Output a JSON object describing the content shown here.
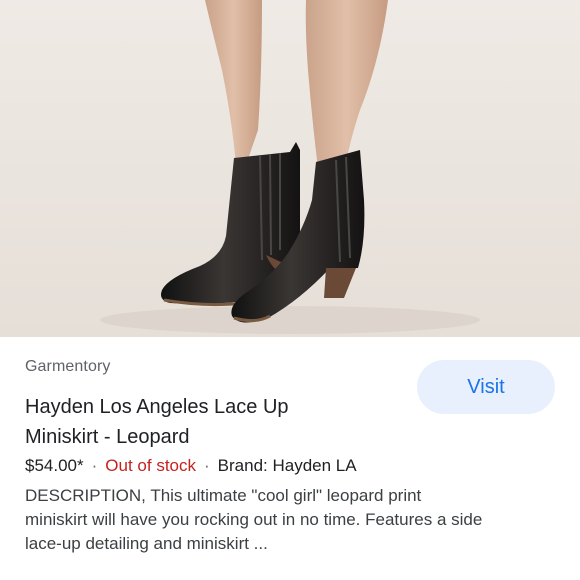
{
  "listing": {
    "image_alt": "Black leather ankle boots",
    "source": "Garmentory",
    "visit_label": "Visit",
    "title_lines": [
      "Hayden Los Angeles Lace Up",
      "Miniskirt - Leopard"
    ],
    "price": "$54.00*",
    "separator": "·",
    "stock_status": "Out of stock",
    "brand": "Brand: Hayden LA",
    "description_lines": [
      "DESCRIPTION, This ultimate \"cool girl\" leopard print",
      "miniskirt will have you rocking out in no time. Features a side",
      "lace-up detailing and miniskirt ..."
    ]
  },
  "colors": {
    "accent": "#1a73e8",
    "visit_bg": "#e8f0fe",
    "out_of_stock": "#c5221f"
  }
}
